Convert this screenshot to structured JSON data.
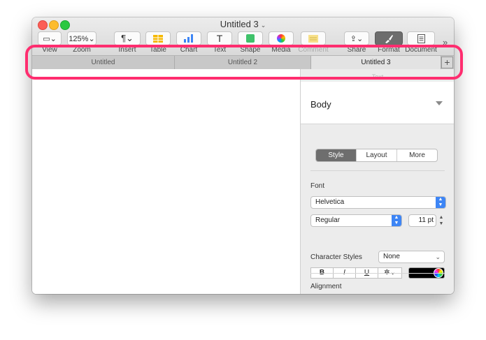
{
  "window": {
    "title": "Untitled 3",
    "title_chevron": "⌄"
  },
  "toolbar": {
    "items": [
      {
        "label": "View",
        "glyph": "▭⌄"
      },
      {
        "label": "Zoom",
        "glyph": "125%⌄"
      },
      {
        "label": "Insert",
        "glyph": "¶⌄"
      },
      {
        "label": "Table",
        "glyph": ""
      },
      {
        "label": "Chart",
        "glyph": ""
      },
      {
        "label": "Text",
        "glyph": "T"
      },
      {
        "label": "Shape",
        "glyph": ""
      },
      {
        "label": "Media",
        "glyph": ""
      },
      {
        "label": "Comment",
        "glyph": ""
      },
      {
        "label": "Share",
        "glyph": "⇪⌄"
      },
      {
        "label": "Format",
        "glyph": ""
      },
      {
        "label": "Document",
        "glyph": ""
      }
    ],
    "overflow": "»"
  },
  "tabs": [
    {
      "label": "Untitled",
      "active": false
    },
    {
      "label": "Untitled 2",
      "active": false
    },
    {
      "label": "Untitled 3",
      "active": true
    }
  ],
  "tab_add": "+",
  "sidebar": {
    "faint_text": "Text",
    "style_name": "Body",
    "segments": [
      "Style",
      "Layout",
      "More"
    ],
    "font_section": "Font",
    "font_family": "Helvetica",
    "font_weight": "Regular",
    "font_size": "11 pt",
    "format_buttons": [
      "B",
      "I",
      "U",
      "✲⌄"
    ],
    "char_styles_label": "Character Styles",
    "char_styles_value": "None",
    "alignment_label": "Alignment",
    "alignment_options": [
      "≡",
      "≡",
      "≡",
      "≡"
    ]
  },
  "colors": {
    "highlight": "#ff2d6f",
    "accent": "#3d85f5"
  }
}
